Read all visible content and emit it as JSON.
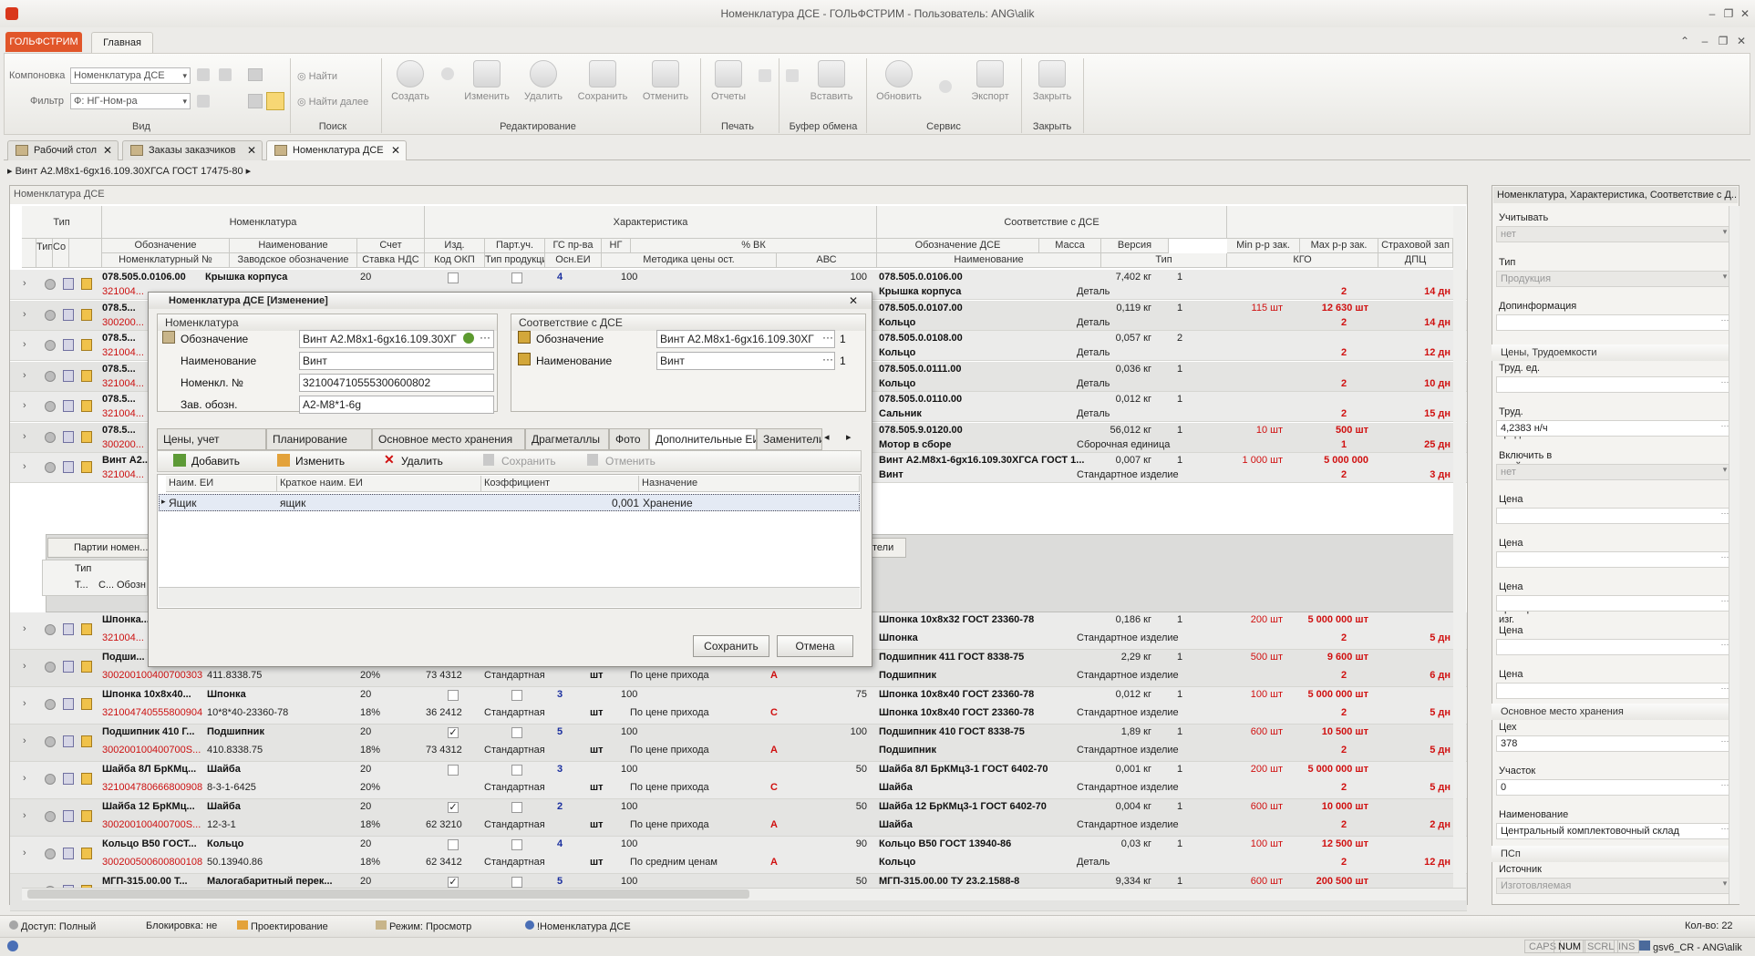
{
  "window": {
    "title": "Номенклатура ДСЕ - ГОЛЬФСТРИМ - Пользователь: ANG\\alik"
  },
  "ribbon": {
    "app_tab": "ГОЛЬФСТРИМ",
    "home_tab": "Главная",
    "layout_label": "Компоновка",
    "layout_value": "Номенклатура ДСЕ",
    "filter_label": "Фильтр",
    "filter_value": "Ф: НГ-Ном-ра",
    "find": "Найти",
    "find_next": "Найти далее",
    "create": "Создать",
    "edit": "Изменить",
    "delete": "Удалить",
    "save": "Сохранить",
    "cancel": "Отменить",
    "reports": "Отчеты",
    "paste": "Вставить",
    "refresh": "Обновить",
    "export": "Экспорт",
    "close": "Закрыть",
    "groups": {
      "view": "Вид",
      "search": "Поиск",
      "editing": "Редактирование",
      "print": "Печать",
      "clipboard": "Буфер обмена",
      "service": "Сервис",
      "close": "Закрыть"
    }
  },
  "doc_tabs": [
    {
      "label": "Рабочий стол"
    },
    {
      "label": "Заказы заказчиков"
    },
    {
      "label": "Номенклатура ДСЕ"
    }
  ],
  "breadcrumb": "Винт А2.М8х1-6gх16.109.30ХГСА ГОСТ 17475-80",
  "grid": {
    "caption": "Номенклатура ДСЕ",
    "bands": {
      "type": "Тип",
      "nomenclature": "Номенклатура",
      "characteristics": "Характеристика",
      "correspondence": "Соответствие с ДСЕ"
    },
    "col1": [
      "Тип",
      "Со"
    ],
    "col1b": [
      "п",
      "с"
    ],
    "headers_top": [
      "Обозначение",
      "Наименование",
      "Счет",
      "Изд.",
      "Парт.уч.",
      "ГС пр-ва",
      "НГ",
      "% ВК",
      "Обозначение ДСЕ",
      "Масса",
      "Версия",
      "Min р-р зак.",
      "Max р-р зак.",
      "Страховой зап"
    ],
    "headers_bottom": [
      "Номенклатурный №",
      "Заводское обозначение",
      "Ставка НДС",
      "Код ОКП",
      "Тип продукции",
      "Осн.ЕИ",
      "Методика цены ост.",
      "АВС",
      "Наименование",
      "Тип",
      "КГО",
      "ДПЦ"
    ],
    "rows": [
      {
        "code": "078.505.0.0106.00",
        "name": "Крышка корпуса",
        "acc": "20",
        "nom": "321004...",
        "nds": "",
        "okp": "",
        "gs": "4",
        "ng": "100",
        "vk": "100",
        "dse": "078.505.0.0106.00",
        "dse_name": "Крышка корпуса",
        "mass": "7,402 кг",
        "ver": "1",
        "type": "Деталь",
        "min": "",
        "max": "",
        "kgo": "2",
        "dpc": "14 дн",
        "abc": ""
      },
      {
        "code": "078.5...",
        "name": "",
        "acc": "",
        "nom": "300200...",
        "nds": "",
        "okp": "",
        "gs": "",
        "ng": "",
        "vk": "",
        "dse": "078.505.0.0107.00",
        "dse_name": "Кольцо",
        "mass": "0,119 кг",
        "ver": "1",
        "type": "Деталь",
        "min": "115 шт",
        "max": "12 630 шт",
        "kgo": "2",
        "dpc": "14 дн",
        "abc": ""
      },
      {
        "code": "078.5...",
        "name": "",
        "acc": "",
        "nom": "321004...",
        "nds": "",
        "okp": "",
        "gs": "",
        "ng": "",
        "vk": "",
        "dse": "078.505.0.0108.00",
        "dse_name": "Кольцо",
        "mass": "0,057 кг",
        "ver": "2",
        "type": "Деталь",
        "min": "",
        "max": "",
        "kgo": "2",
        "dpc": "12 дн",
        "abc": ""
      },
      {
        "code": "078.5...",
        "name": "",
        "acc": "",
        "nom": "321004...",
        "nds": "",
        "okp": "",
        "gs": "",
        "ng": "",
        "vk": "",
        "dse": "078.505.0.0111.00",
        "dse_name": "Кольцо",
        "mass": "0,036 кг",
        "ver": "1",
        "type": "Деталь",
        "min": "",
        "max": "",
        "kgo": "2",
        "dpc": "10 дн",
        "abc": ""
      },
      {
        "code": "078.5...",
        "name": "",
        "acc": "",
        "nom": "321004...",
        "nds": "",
        "okp": "",
        "gs": "",
        "ng": "",
        "vk": "",
        "dse": "078.505.0.0110.00",
        "dse_name": "Сальник",
        "mass": "0,012 кг",
        "ver": "1",
        "type": "Деталь",
        "min": "",
        "max": "",
        "kgo": "2",
        "dpc": "15 дн",
        "abc": ""
      },
      {
        "code": "078.5...",
        "name": "",
        "acc": "",
        "nom": "300200...",
        "nds": "",
        "okp": "",
        "gs": "",
        "ng": "",
        "vk": "",
        "dse": "078.505.9.0120.00",
        "dse_name": "Мотор в сборе",
        "mass": "56,012 кг",
        "ver": "1",
        "type": "Сборочная единица",
        "min": "10 шт",
        "max": "500 шт",
        "kgo": "1",
        "dpc": "25 дн",
        "abc": ""
      },
      {
        "code": "Винт А2...",
        "name": "",
        "acc": "",
        "nom": "321004...",
        "nds": "",
        "okp": "",
        "gs": "",
        "ng": "",
        "vk": "",
        "dse": "Винт А2.М8х1-6gх16.109.30ХГСА ГОСТ 1...",
        "dse_name": "Винт",
        "mass": "0,007 кг",
        "ver": "1",
        "type": "Стандартное изделие",
        "min": "1 000 шт",
        "max": "5 000 000",
        "kgo": "2",
        "dpc": "3 дн",
        "abc": ""
      }
    ],
    "detail": {
      "tab": "Партии номен...",
      "col_type": "Тип",
      "col_t": "Т...",
      "col_c": "С...",
      "col_obozn": "Обозн",
      "right_tab": "тели"
    },
    "rows2": [
      {
        "code": "Шпонка...",
        "name": "",
        "acc": "",
        "nom": "321004...",
        "nds": "",
        "okp": "",
        "ptype": "",
        "unit": "",
        "method": "",
        "abc": "",
        "gs": "",
        "ng": "",
        "vk": "",
        "dse": "Шпонка 10х8х32 ГОСТ 23360-78",
        "dse_name": "Шпонка",
        "mass": "0,186 кг",
        "ver": "1",
        "type": "Стандартное изделие",
        "min": "200 шт",
        "max": "5 000 000 шт",
        "kgo": "2",
        "dpc": "5 дн"
      },
      {
        "code": "Подши...",
        "name": "",
        "acc": "",
        "nom": "300200100400700303",
        "fact": "411.8338.75",
        "nds": "20%",
        "okp": "73 4312",
        "ptype": "Стандартная",
        "unit": "шт",
        "method": "По цене прихода",
        "abc": "A",
        "gs": "",
        "ng": "",
        "vk": "",
        "dse": "Подшипник 411 ГОСТ 8338-75",
        "dse_name": "Подшипник",
        "mass": "2,29 кг",
        "ver": "1",
        "type": "Стандартное изделие",
        "min": "500 шт",
        "max": "9 600 шт",
        "kgo": "2",
        "dpc": "6 дн"
      },
      {
        "code": "Шпонка 10х8х40...",
        "name": "Шпонка",
        "acc": "20",
        "nom": "321004740555800904",
        "fact": "10*8*40-23360-78",
        "nds": "18%",
        "okp": "36 2412",
        "ptype": "Стандартная",
        "unit": "шт",
        "method": "По цене прихода",
        "abc": "C",
        "gs": "3",
        "ng": "100",
        "vk": "75",
        "dse": "Шпонка 10х8х40 ГОСТ 23360-78",
        "dse_name": "Шпонка 10х8х40 ГОСТ 23360-78",
        "mass": "0,012 кг",
        "ver": "1",
        "type": "Стандартное изделие",
        "min": "100 шт",
        "max": "5 000 000 шт",
        "kgo": "2",
        "dpc": "5 дн"
      },
      {
        "code": "Подшипник 410 Г...",
        "name": "Подшипник",
        "acc": "20",
        "nom": "300200100400700S...",
        "fact": "410.8338.75",
        "nds": "18%",
        "okp": "73 4312",
        "ptype": "Стандартная",
        "unit": "шт",
        "method": "По цене прихода",
        "abc": "A",
        "gs": "5",
        "ng": "100",
        "vk": "100",
        "dse": "Подшипник 410 ГОСТ 8338-75",
        "dse_name": "Подшипник",
        "mass": "1,89 кг",
        "ver": "1",
        "type": "Стандартное изделие",
        "min": "600 шт",
        "max": "10 500 шт",
        "kgo": "2",
        "dpc": "5 дн"
      },
      {
        "code": "Шайба 8Л БрКМц...",
        "name": "Шайба",
        "acc": "20",
        "nom": "321004780666800908",
        "fact": "8-3-1-6425",
        "nds": "20%",
        "okp": "",
        "ptype": "Стандартная",
        "unit": "шт",
        "method": "По цене прихода",
        "abc": "C",
        "gs": "3",
        "ng": "100",
        "vk": "50",
        "dse": "Шайба 8Л БрКМц3-1 ГОСТ 6402-70",
        "dse_name": "Шайба",
        "mass": "0,001 кг",
        "ver": "1",
        "type": "Стандартное изделие",
        "min": "200 шт",
        "max": "5 000 000 шт",
        "kgo": "2",
        "dpc": "5 дн"
      },
      {
        "code": "Шайба 12 БрКМц...",
        "name": "Шайба",
        "acc": "20",
        "nom": "300200100400700S...",
        "fact": "12-3-1",
        "nds": "18%",
        "okp": "62 3210",
        "ptype": "Стандартная",
        "unit": "шт",
        "method": "По цене прихода",
        "abc": "A",
        "gs": "2",
        "ng": "100",
        "vk": "50",
        "dse": "Шайба 12 БрКМц3-1 ГОСТ 6402-70",
        "dse_name": "Шайба",
        "mass": "0,004 кг",
        "ver": "1",
        "type": "Стандартное изделие",
        "min": "600 шт",
        "max": "10 000 шт",
        "kgo": "2",
        "dpc": "2 дн"
      },
      {
        "code": "Кольцо В50 ГОСТ...",
        "name": "Кольцо",
        "acc": "20",
        "nom": "300200500600800108",
        "fact": "50.13940.86",
        "nds": "18%",
        "okp": "62 3412",
        "ptype": "Стандартная",
        "unit": "шт",
        "method": "По средним ценам",
        "abc": "A",
        "gs": "4",
        "ng": "100",
        "vk": "90",
        "dse": "Кольцо В50 ГОСТ 13940-86",
        "dse_name": "Кольцо",
        "mass": "0,03 кг",
        "ver": "1",
        "type": "Деталь",
        "min": "100 шт",
        "max": "12 500 шт",
        "kgo": "2",
        "dpc": "12 дн"
      },
      {
        "code": "МГП-315.00.00 Т...",
        "name": "Малогабаритный перек...",
        "acc": "20",
        "nom": "",
        "fact": "",
        "nds": "",
        "okp": "",
        "ptype": "",
        "unit": "",
        "method": "",
        "abc": "",
        "gs": "5",
        "ng": "100",
        "vk": "50",
        "dse": "МГП-315.00.00 ТУ 23.2.1588-8",
        "dse_name": "",
        "mass": "9,334 кг",
        "ver": "1",
        "type": "",
        "min": "600 шт",
        "max": "200 500 шт",
        "kgo": "",
        "dpc": ""
      }
    ]
  },
  "dialog": {
    "title": "Номенклатура ДСЕ [Изменение]",
    "group_nom": "Номенклатура",
    "group_corr": "Соответствие с ДСЕ",
    "lbl_obozn": "Обозначение",
    "val_obozn": "Винт А2.М8х1-6gх16.109.30ХГ",
    "lbl_name": "Наименование",
    "val_name": "Винт",
    "lbl_nomnum": "Номенкл. №",
    "val_nomnum": "321004710555300600802",
    "lbl_zav": "Зав. обозн.",
    "val_zav": "А2-М8*1-6g",
    "c_lbl_obozn": "Обозначение",
    "c_val_obozn": "Винт А2.М8х1-6gх16.109.30ХГ",
    "c_n1": "1",
    "c_lbl_name": "Наименование",
    "c_val_name": "Винт",
    "c_n2": "1",
    "tabs": [
      "Цены, учет",
      "Планирование",
      "Основное место хранения",
      "Драгметаллы",
      "Фото",
      "Дополнительные ЕИ",
      "Заменители"
    ],
    "tb_add": "Добавить",
    "tb_edit": "Изменить",
    "tb_delete": "Удалить",
    "tb_save": "Сохранить",
    "tb_cancel": "Отменить",
    "cols": [
      "Наим. ЕИ",
      "Краткое наим. ЕИ",
      "Коэффициент",
      "Назначение"
    ],
    "row": {
      "name": "Ящик",
      "short": "ящик",
      "coef": "0,001",
      "purpose": "Хранение"
    },
    "save": "Сохранить",
    "cancel": "Отмена"
  },
  "side": {
    "title": "Номенклатура, Характеристика, Соответствие с Д...",
    "f1_label": "Учитывать экземпляры",
    "f1_val": "нет",
    "f2_label": "Тип номенклатуры",
    "f2_val": "Продукция",
    "f3_label": "Допинформация",
    "f3_val": "",
    "sect_prices": "Цены, Трудоемкости",
    "f4_label": "Труд. ед. последнего изг.",
    "f4_val": "",
    "f5_label": "Труд. ед. средняя",
    "f5_val": "4,2383 н/ч",
    "f6_label": "Включить в прейскурант",
    "f6_val": "нет",
    "f7_label": "Цена максимальная",
    "f7_val": "",
    "f8_label": "Цена план",
    "f8_val": "",
    "f9_label": "Цена последнего приобр./изг.",
    "f9_val": "",
    "f10_label": "Цена средняя",
    "f10_val": "",
    "f11_label": "Цена продажи",
    "f11_val": "",
    "sect_storage": "Основное место хранения",
    "f12_label": "Цех",
    "f12_val": "378",
    "f13_label": "Участок",
    "f13_val": "0",
    "f14_label": "Наименование",
    "f14_val": "Центральный комплектовочный склад",
    "sect_psp": "ПСп",
    "f15_label": "Источник поступления",
    "f15_val": "Изготовляемая"
  },
  "status": {
    "access": "Доступ: Полный",
    "lock": "Блокировка: не",
    "design": "Проектирование",
    "mode": "Режим: Просмотр",
    "doc": "!Номенклатура ДСЕ",
    "count": "Кол-во: 22",
    "caps": "CAPS",
    "num": "NUM",
    "scrl": "SCRL",
    "ins": "INS",
    "user": "gsv6_CR - ANG\\alik"
  }
}
